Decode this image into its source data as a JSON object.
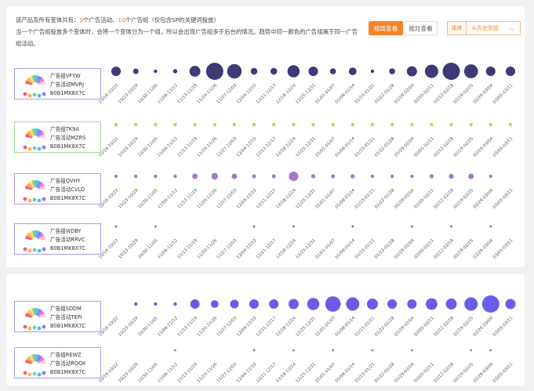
{
  "intro": {
    "line1_prefix": "该产品及所有变体共有：",
    "activities_count": "9",
    "activities_suffix": "个广告活动、",
    "groups_count": "10",
    "groups_suffix": "个广告组（仅包含SP的关键词投放）",
    "line2": "当一个广告组投放多个变体时，会将一个变体分为一个组，所以会出现广告组多于后台的情况。趋势中同一颜色的广告组属于同一广告组活动。"
  },
  "controls": {
    "weekly_label": "按周查看",
    "monthly_label": "按月查看",
    "sort_label": "排序",
    "sort_value": "从历史到前",
    "accent_color": "#f5822a"
  },
  "weeks": [
    "10/16-10/22",
    "10/23-10/29",
    "10/30-11/05",
    "11/06-11/12",
    "11/13-11/19",
    "11/20-11/26",
    "11/27-12/03",
    "12/04-12/10",
    "12/11-12/17",
    "12/18-12/24",
    "12/25-12/31",
    "01/01-01/07",
    "01/08-01/14",
    "01/15-01/21",
    "01/22-01/28",
    "01/29-02/04",
    "02/05-02/11",
    "02/12-02/18",
    "02/19-02/25",
    "02/26-03/04",
    "03/05-03/11"
  ],
  "ad_groups": [
    {
      "group": "广告组VFYW",
      "activity": "广告活动MVRJ",
      "asin": "B0B1MK8X7C",
      "color": "#3d3a77",
      "border_color": "#a99de6",
      "sizes": [
        3,
        1,
        0.4,
        0.6,
        4,
        10,
        7,
        1.5,
        1.5,
        5,
        3,
        1.2,
        2,
        0.4,
        1.2,
        3.5,
        6,
        10,
        6.5,
        3,
        3
      ]
    },
    {
      "group": "广告组TK9A",
      "activity": "广告活动MZRS",
      "asin": "B0B1MK8X7C",
      "color": "#d9c84a",
      "border_color": "#a8d89a",
      "sizes": [
        0.4,
        0.4,
        0.4,
        0.4,
        0.4,
        0.4,
        0.4,
        0.4,
        0.4,
        0.4,
        0.4,
        0.4,
        0.4,
        0.4,
        0.4,
        0.4,
        0.4,
        0.4,
        0.4,
        0.4,
        0.4
      ]
    },
    {
      "group": "广告组QVHY",
      "activity": "广告活动CVLO",
      "asin": "B0B1MK8X7C",
      "color": "#a677cf",
      "border_color": "#b99ce2",
      "sizes": [
        0.4,
        0.4,
        0.4,
        0.4,
        1,
        1.5,
        1,
        0.5,
        0.5,
        3,
        0.6,
        0.5,
        0.6,
        0.4,
        0.4,
        0.4,
        0.6,
        0.8,
        1,
        0.4,
        0
      ]
    },
    {
      "group": "广告组WDBY",
      "activity": "广告活动RRVC",
      "asin": "B0B1MK8X7C",
      "color": "#6d6d86",
      "border_color": "#a99de6",
      "sizes": [
        0.15,
        0,
        0.15,
        0,
        0,
        0,
        0,
        0.15,
        0,
        0.15,
        0,
        0,
        0.15,
        0,
        0,
        0.15,
        0,
        0.15,
        0,
        0.15,
        0
      ]
    },
    {
      "group": "广告组SDDM",
      "activity": "广告活动TEPI",
      "asin": "B0B1MK8X7C",
      "color": "#6a5ce6",
      "border_color": "#a99de6",
      "sizes": [
        0,
        0.4,
        0.4,
        0.4,
        3,
        2,
        2.5,
        3,
        3,
        3.5,
        5,
        8,
        6,
        4,
        3,
        3,
        4.5,
        4,
        6,
        10,
        3.5
      ]
    },
    {
      "group": "广告组REWZ",
      "activity": "广告活动ROOX",
      "asin": "B0B1MK8X7C",
      "color": "#8484a0",
      "border_color": "#a99de6",
      "sizes": [
        0,
        0,
        0,
        0.15,
        0,
        0,
        0,
        0.15,
        0,
        0.15,
        0,
        0.15,
        0,
        0.15,
        0,
        0.15,
        0,
        0,
        0.15,
        0.15,
        0
      ]
    }
  ]
}
